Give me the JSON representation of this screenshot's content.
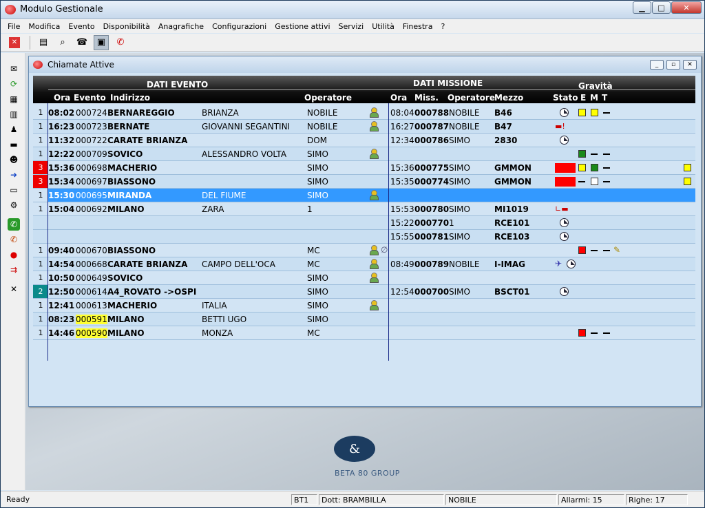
{
  "app": {
    "title": "Modulo Gestionale"
  },
  "menu": [
    "File",
    "Modifica",
    "Evento",
    "Disponibilità",
    "Anagrafiche",
    "Configurazioni",
    "Gestione attivi",
    "Servizi",
    "Utilità",
    "Finestra",
    "?"
  ],
  "child": {
    "title": "Chiamate Attive"
  },
  "headers": {
    "dati_evento": "DATI EVENTO",
    "dati_missione": "DATI MISSIONE",
    "gravita": "Gravità",
    "ora": "Ora",
    "evento": "Evento",
    "indirizzo": "Indirizzo",
    "operatore": "Operatore",
    "ora2": "Ora",
    "miss": "Miss.",
    "operatore2": "Operatore",
    "mezzo": "Mezzo",
    "stato": "Stato",
    "e": "E",
    "m": "M",
    "t": "T"
  },
  "rows": [
    {
      "p": "1",
      "ora": "08:02",
      "ev": "000724",
      "loc": "BERNAREGGIO",
      "via": "BRIANZA",
      "op": "NOBILE",
      "mora": "08:04",
      "miss": "000788",
      "mop": "NOBILE",
      "mezzo": "B46"
    },
    {
      "p": "1",
      "ora": "16:23",
      "ev": "000723",
      "loc": "BERNATE",
      "via": "GIOVANNI SEGANTINI",
      "op": "NOBILE",
      "mora": "16:27",
      "miss": "000787",
      "mop": "NOBILE",
      "mezzo": "B47"
    },
    {
      "p": "1",
      "ora": "11:32",
      "ev": "000722",
      "loc": "CARATE BRIANZA",
      "via": "",
      "op": "DOM",
      "mora": "12:34",
      "miss": "000786",
      "mop": "SIMO",
      "mezzo": "2830"
    },
    {
      "p": "1",
      "ora": "12:22",
      "ev": "000709",
      "loc": "SOVICO",
      "via": "ALESSANDRO VOLTA",
      "op": "SIMO",
      "mora": "",
      "miss": "",
      "mop": "",
      "mezzo": ""
    },
    {
      "p": "3",
      "ora": "15:36",
      "ev": "000698",
      "loc": "MACHERIO",
      "via": "",
      "op": "SIMO",
      "mora": "15:36",
      "miss": "000775",
      "mop": "SIMO",
      "mezzo": "GMMON"
    },
    {
      "p": "3",
      "ora": "15:34",
      "ev": "000697",
      "loc": "BIASSONO",
      "via": "",
      "op": "SIMO",
      "mora": "15:35",
      "miss": "000774",
      "mop": "SIMO",
      "mezzo": "GMMON"
    },
    {
      "p": "1",
      "ora": "15:30",
      "ev": "000695",
      "loc": "MIRANDA",
      "via": "DEL FIUME",
      "op": "SIMO",
      "mora": "",
      "miss": "",
      "mop": "",
      "mezzo": ""
    },
    {
      "p": "1",
      "ora": "15:04",
      "ev": "000692",
      "loc": "MILANO",
      "via": "ZARA",
      "op": "1",
      "mora": "15:53",
      "miss": "000780",
      "mop": "SIMO",
      "mezzo": "MI1019"
    },
    {
      "p": "",
      "ora": "",
      "ev": "",
      "loc": "",
      "via": "",
      "op": "",
      "mora": "15:22",
      "miss": "000770",
      "mop": "1",
      "mezzo": "RCE101"
    },
    {
      "p": "",
      "ora": "",
      "ev": "",
      "loc": "",
      "via": "",
      "op": "",
      "mora": "15:55",
      "miss": "000781",
      "mop": "SIMO",
      "mezzo": "RCE103"
    },
    {
      "p": "1",
      "ora": "09:40",
      "ev": "000670",
      "loc": "BIASSONO",
      "via": "",
      "op": "MC",
      "mora": "",
      "miss": "",
      "mop": "",
      "mezzo": ""
    },
    {
      "p": "1",
      "ora": "14:54",
      "ev": "000668",
      "loc": "CARATE BRIANZA",
      "via": "CAMPO DELL'OCA",
      "op": "MC",
      "mora": "08:49",
      "miss": "000789",
      "mop": "NOBILE",
      "mezzo": "I-IMAG"
    },
    {
      "p": "1",
      "ora": "10:50",
      "ev": "000649",
      "loc": "SOVICO",
      "via": "",
      "op": "SIMO",
      "mora": "",
      "miss": "",
      "mop": "",
      "mezzo": ""
    },
    {
      "p": "2",
      "ora": "12:50",
      "ev": "000614",
      "loc": "A4_ROVATO ->OSPI",
      "via": "",
      "op": "SIMO",
      "mora": "12:54",
      "miss": "000700",
      "mop": "SIMO",
      "mezzo": "BSCT01"
    },
    {
      "p": "1",
      "ora": "12:41",
      "ev": "000613",
      "loc": "MACHERIO",
      "via": "ITALIA",
      "op": "SIMO",
      "mora": "",
      "miss": "",
      "mop": "",
      "mezzo": ""
    },
    {
      "p": "1",
      "ora": "08:23",
      "ev": "000591",
      "loc": "MILANO",
      "via": "BETTI UGO",
      "op": "SIMO",
      "mora": "",
      "miss": "",
      "mop": "",
      "mezzo": ""
    },
    {
      "p": "1",
      "ora": "14:46",
      "ev": "000590",
      "loc": "MILANO",
      "via": "MONZA",
      "op": "MC",
      "mora": "",
      "miss": "",
      "mop": "",
      "mezzo": ""
    }
  ],
  "logo": {
    "text": "BETA 80 GROUP"
  },
  "status": {
    "ready": "Ready",
    "bt": "BT1",
    "dott": "Dott: BRAMBILLA",
    "op": "NOBILE",
    "allarmi": "Allarmi: 15",
    "righe": "Righe: 17"
  }
}
